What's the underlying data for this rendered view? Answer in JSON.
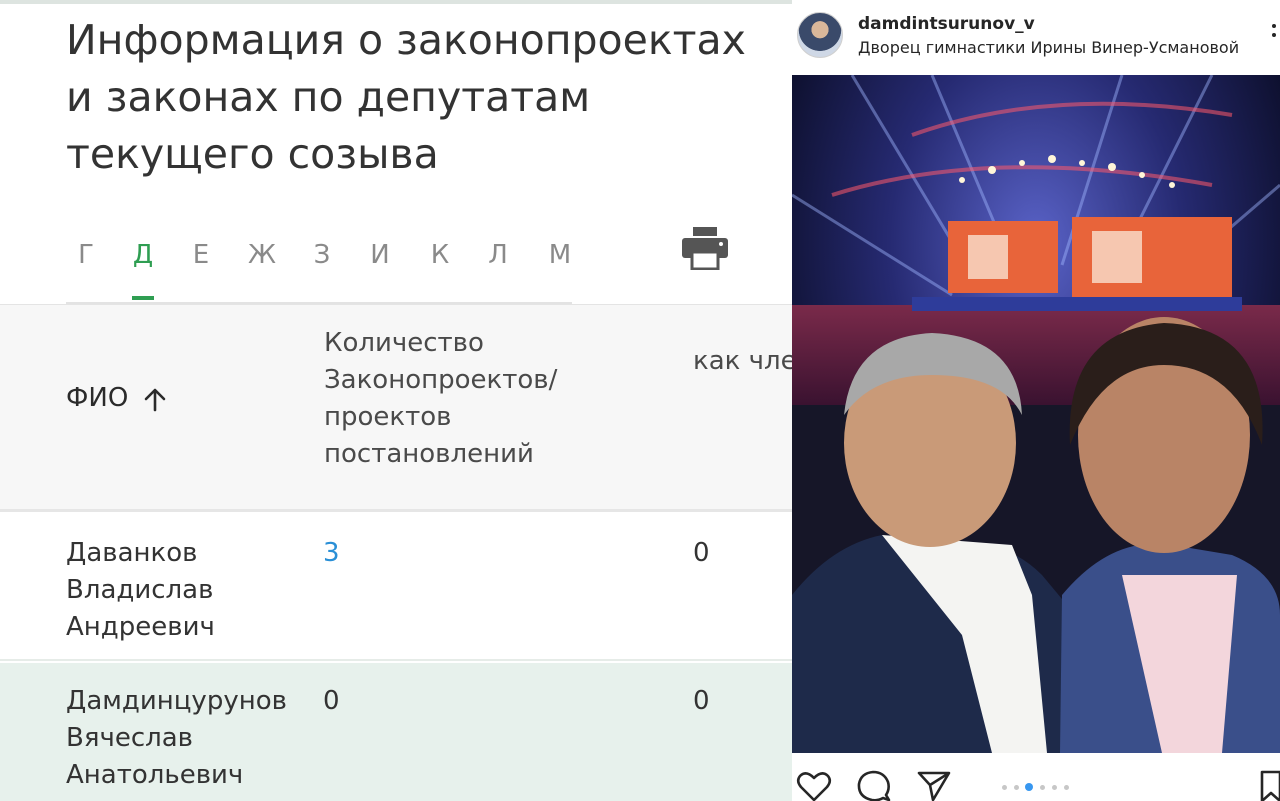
{
  "left": {
    "title": "Информация о законопроектах и законах по депутатам текущего созыва",
    "letters": [
      "Г",
      "Д",
      "Е",
      "Ж",
      "З",
      "И",
      "К",
      "Л",
      "М"
    ],
    "active_letter": "Д",
    "table": {
      "headers": {
        "fio": "ФИО",
        "count": "Количество Законопроектов/ проектов постановлений",
        "council": "как член Совета Федерации"
      },
      "rows": [
        {
          "name": "Даванков Владислав Андреевич",
          "count": "3",
          "council": "0"
        },
        {
          "name": "Дамдинцурунов Вячеслав Анатольевич",
          "count": "0",
          "council": "0"
        }
      ]
    }
  },
  "right": {
    "username": "damdintsurunov_v",
    "location": "Дворец гимнастики Ирины Винер-Усмановой",
    "carousel": {
      "count": 6,
      "active_index": 2
    }
  },
  "colors": {
    "accent_green": "#2f9e52",
    "link_blue": "#2a8fd6",
    "highlight_row": "#e7f1ec",
    "instagram_blue": "#3897f0"
  },
  "icons": [
    "print-icon",
    "sort-arrow-up-icon",
    "heart-icon",
    "comment-icon",
    "share-icon",
    "bookmark-icon",
    "more-icon"
  ]
}
